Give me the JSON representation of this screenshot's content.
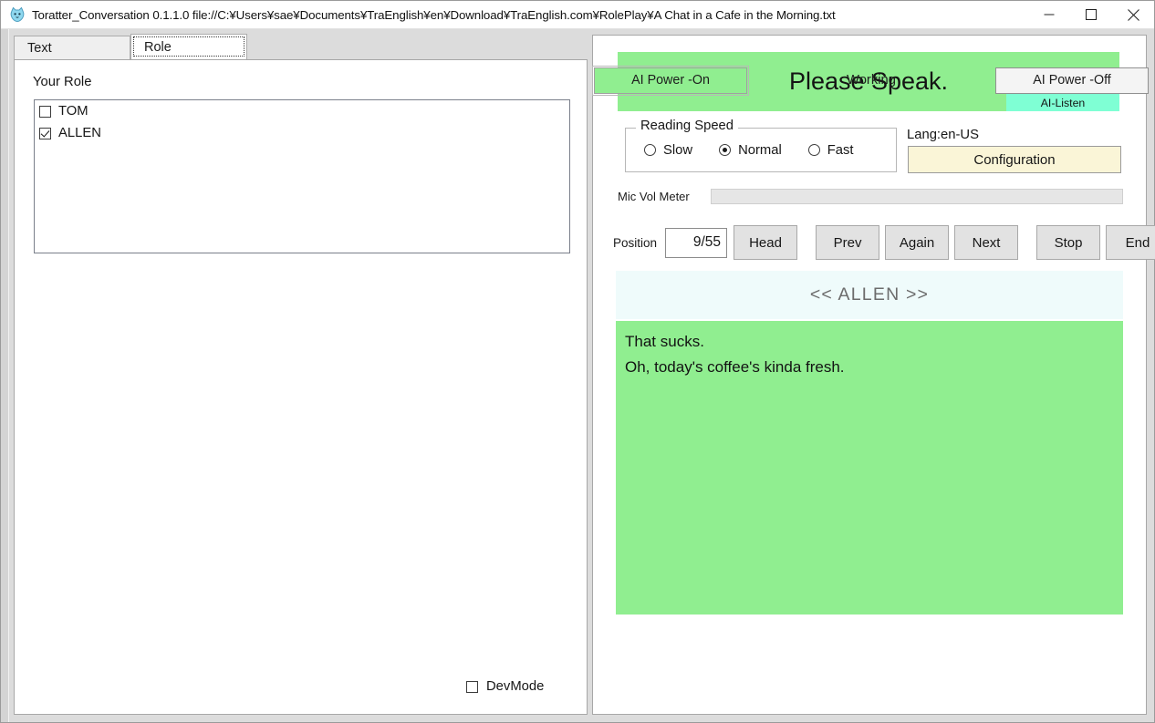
{
  "window": {
    "title": "Toratter_Conversation 0.1.1.0  file://C:¥Users¥sae¥Documents¥TraEnglish¥en¥Download¥TraEnglish.com¥RolePlay¥A Chat in a Cafe in the Morning.txt",
    "app_icon": "cat-face-icon",
    "minimize_label": "minimize-icon",
    "maximize_label": "maximize-icon",
    "close_label": "close-icon"
  },
  "tabs": [
    {
      "label": "Text",
      "active": false
    },
    {
      "label": "Role",
      "active": true
    }
  ],
  "left_panel": {
    "your_role_label": "Your Role",
    "roles": [
      {
        "label": "TOM",
        "checked": false
      },
      {
        "label": "ALLEN",
        "checked": true
      }
    ],
    "devmode": {
      "label": "DevMode",
      "checked": false
    }
  },
  "right_panel": {
    "ai_power_on_label": "AI Power -On",
    "working_label": "Working",
    "ai_power_off_label": "AI Power -Off",
    "speak_banner": {
      "text": "Please Speak.",
      "badge": "AI-Listen"
    },
    "reading_speed": {
      "legend": "Reading Speed",
      "options": [
        {
          "label": "Slow",
          "selected": false
        },
        {
          "label": "Normal",
          "selected": true
        },
        {
          "label": "Fast",
          "selected": false
        }
      ]
    },
    "lang_label": "Lang:en-US",
    "configuration_label": "Configuration",
    "mic_vol_meter_label": "Mic Vol Meter",
    "mic_vol_level": 0,
    "position": {
      "label": "Position",
      "value": "9/55"
    },
    "nav_buttons": [
      {
        "label": "Head"
      },
      {
        "label": "Prev"
      },
      {
        "label": "Again"
      },
      {
        "label": "Next"
      },
      {
        "label": "Stop"
      },
      {
        "label": "End"
      }
    ],
    "speaker_header": "<< ALLEN >>",
    "dialogue_lines": [
      "That sucks.",
      "Oh, today's coffee's kinda fresh."
    ]
  },
  "colors": {
    "accent_green": "#90ee90",
    "listen_badge": "#7fffd4",
    "config_button": "#faf5d7",
    "speaker_header_bg": "#effbfb"
  }
}
